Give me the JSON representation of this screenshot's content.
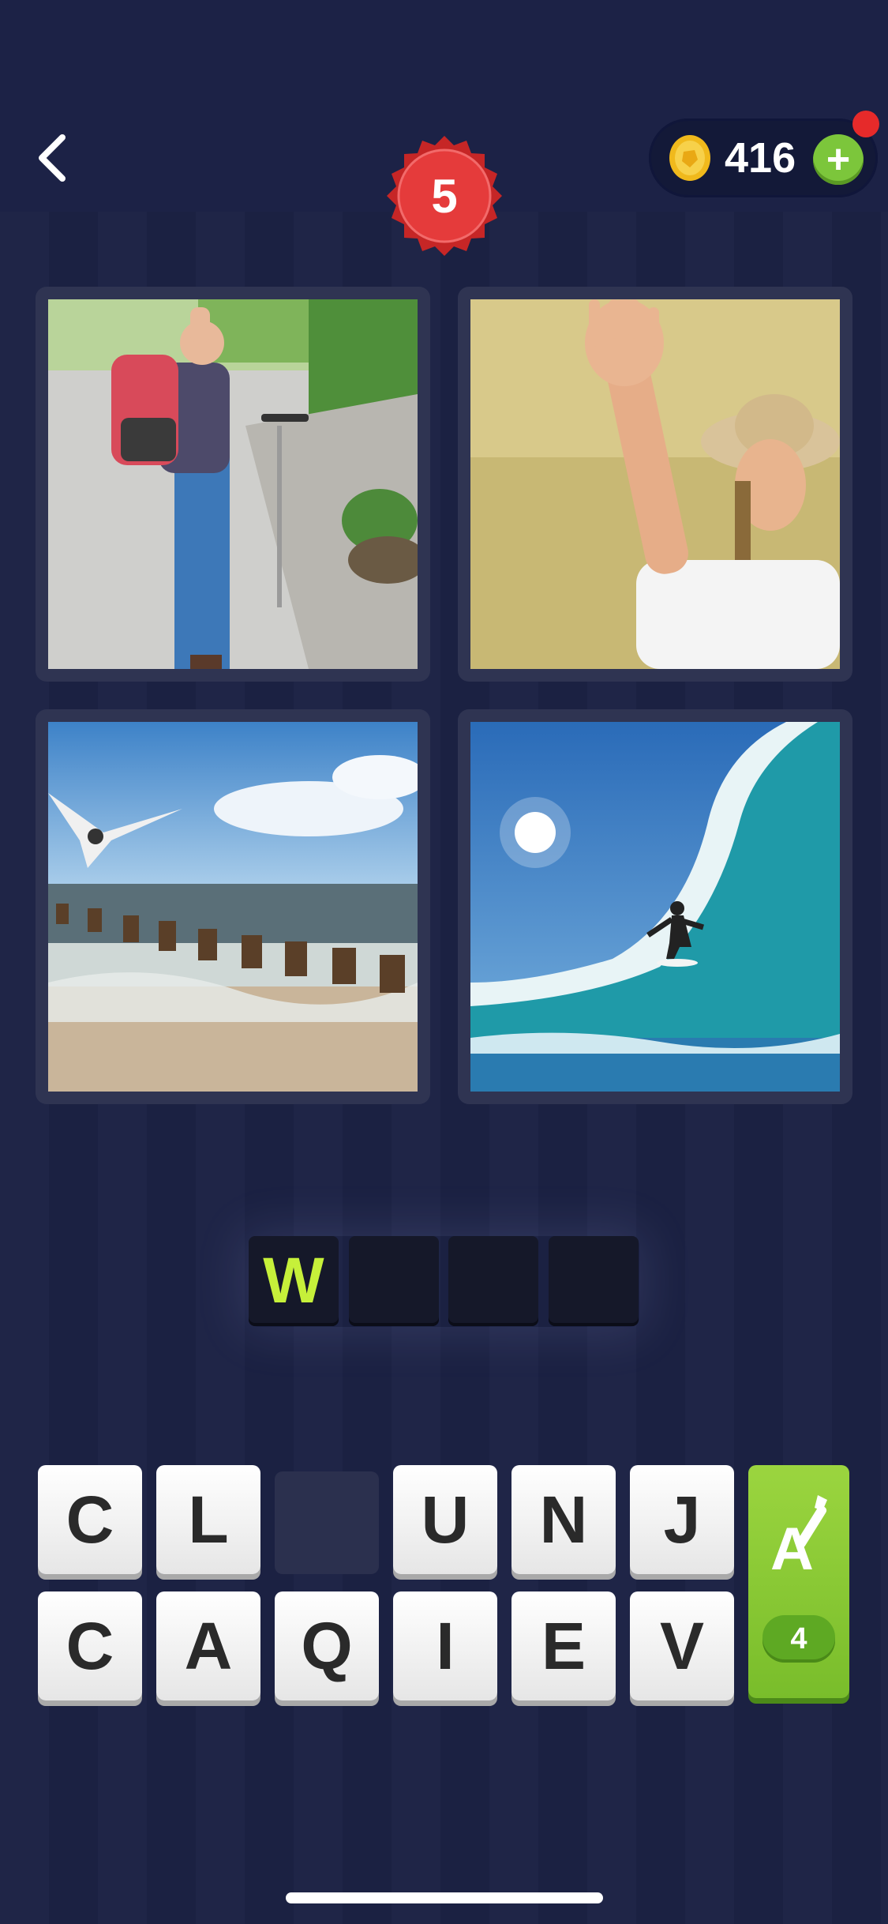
{
  "header": {
    "level": "5",
    "coins": "416",
    "plus_label": "+"
  },
  "pictures": [
    {
      "subject": "child-waving-with-scooter"
    },
    {
      "subject": "woman-waving-in-field"
    },
    {
      "subject": "ocean-waves-with-seagull"
    },
    {
      "subject": "surfer-on-wave"
    }
  ],
  "answer": {
    "slots": [
      "W",
      "",
      "",
      ""
    ]
  },
  "letters": {
    "row1": [
      "C",
      "L",
      "",
      "U",
      "N",
      "J"
    ],
    "row2": [
      "C",
      "A",
      "Q",
      "I",
      "E",
      "V"
    ]
  },
  "hint": {
    "count": "4"
  },
  "colors": {
    "background": "#1f2547",
    "accent_green": "#7cc63b",
    "level_red": "#e23a3a",
    "revealed_letter": "#c6f03a"
  }
}
